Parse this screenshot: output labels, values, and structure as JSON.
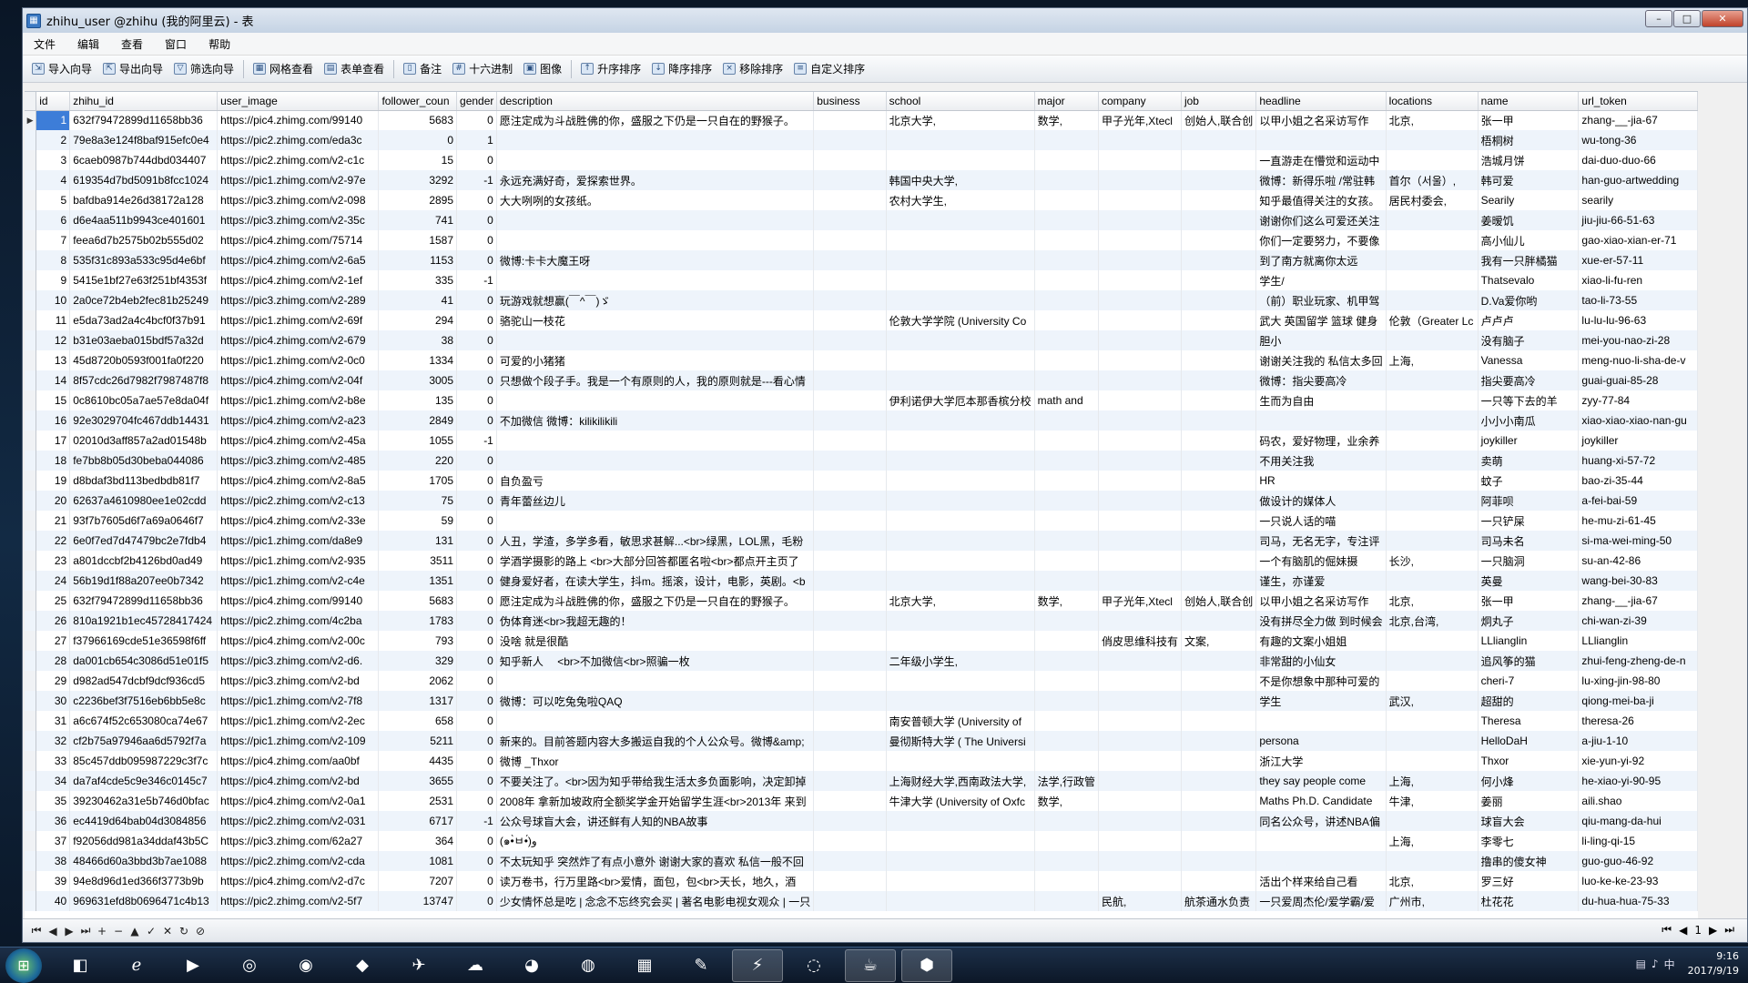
{
  "window": {
    "title": "zhihu_user @zhihu (我的阿里云) - 表"
  },
  "menu": [
    "文件",
    "编辑",
    "查看",
    "窗口",
    "帮助"
  ],
  "toolbar": {
    "import": "导入向导",
    "export": "导出向导",
    "filter": "筛选向导",
    "grid_view": "网格查看",
    "form_view": "表单查看",
    "memo": "备注",
    "hex": "十六进制",
    "image": "图像",
    "sort_asc": "升序排序",
    "sort_desc": "降序排序",
    "remove_sort": "移除排序",
    "custom_sort": "自定义排序"
  },
  "columns": [
    "id",
    "zhihu_id",
    "user_image",
    "follower_coun",
    "gender",
    "description",
    "business",
    "school",
    "major",
    "company",
    "job",
    "headline",
    "locations",
    "name",
    "url_token"
  ],
  "rows": [
    [
      "1",
      "632f79472899d11658bb36",
      "https://pic4.zhimg.com/99140",
      "5683",
      "0",
      "愿注定成为斗战胜佛的你，盛服之下仍是一只自在的野猴子。",
      "",
      "北京大学,",
      "数学,",
      "甲子光年,Xtecl",
      "创始人,联合创",
      "以甲小姐之名采访写作",
      "北京,",
      "张一甲",
      "zhang-__-jia-67"
    ],
    [
      "2",
      "79e8a3e124f8baf915efc0e4",
      "https://pic2.zhimg.com/eda3c",
      "0",
      "1",
      "",
      "",
      "",
      "",
      "",
      "",
      "",
      "",
      "梧桐树",
      "wu-tong-36"
    ],
    [
      "3",
      "6caeb0987b744dbd034407",
      "https://pic2.zhimg.com/v2-c1c",
      "15",
      "0",
      "",
      "",
      "",
      "",
      "",
      "",
      "一直游走在懵觉和运动中",
      "",
      "浩城月饼",
      "dai-duo-duo-66"
    ],
    [
      "4",
      "619354d7bd5091b8fcc1024",
      "https://pic1.zhimg.com/v2-97e",
      "3292",
      "-1",
      "永远充满好奇，爱探索世界。",
      "",
      "韩国中央大学,",
      "",
      "",
      "",
      "微博：新得乐啦 /常驻韩",
      "首尔（서울）,",
      "韩可爱",
      "han-guo-artwedding"
    ],
    [
      "5",
      "bafdba914e26d38172a128",
      "https://pic3.zhimg.com/v2-098",
      "2895",
      "0",
      "大大咧咧的女孩纸。",
      "",
      "农村大学生,",
      "",
      "",
      "",
      "知乎最值得关注的女孩。",
      "居民村委会,",
      "Searily",
      "searily"
    ],
    [
      "6",
      "d6e4aa511b9943ce401601",
      "https://pic3.zhimg.com/v2-35c",
      "741",
      "0",
      "",
      "",
      "",
      "",
      "",
      "",
      "谢谢你们这么可爱还关注",
      "",
      "姜暧饥",
      "jiu-jiu-66-51-63"
    ],
    [
      "7",
      "feea6d7b2575b02b555d02",
      "https://pic4.zhimg.com/75714",
      "1587",
      "0",
      "",
      "",
      "",
      "",
      "",
      "",
      "你们一定要努力，不要像",
      "",
      "高小仙儿",
      "gao-xiao-xian-er-71"
    ],
    [
      "8",
      "535f31c893a533c95d4e6bf",
      "https://pic4.zhimg.com/v2-6a5",
      "1153",
      "0",
      "微博:卡卡大魔王呀",
      "",
      "",
      "",
      "",
      "",
      "到了南方就离你太远",
      "",
      "我有一只胖橘猫",
      "xue-er-57-11"
    ],
    [
      "9",
      "5415e1bf27e63f251bf4353f",
      "https://pic4.zhimg.com/v2-1ef",
      "335",
      "-1",
      "",
      "",
      "",
      "",
      "",
      "",
      "学生/",
      "",
      "Thatsevalo",
      "xiao-li-fu-ren"
    ],
    [
      "10",
      "2a0ce72b4eb2fec81b25249",
      "https://pic3.zhimg.com/v2-289",
      "41",
      "0",
      "玩游戏就想赢(￣^￣)ゞ",
      "",
      "",
      "",
      "",
      "",
      "（前）职业玩家、机甲驾",
      "",
      "D.Va爱你哟",
      "tao-li-73-55"
    ],
    [
      "11",
      "e5da73ad2a4c4bcf0f37b91",
      "https://pic1.zhimg.com/v2-69f",
      "294",
      "0",
      "骆驼山一枝花",
      "",
      "伦敦大学学院 (University Co",
      "",
      "",
      "",
      "武大 英国留学 篮球 健身",
      "伦敦（Greater Lc",
      "卢卢卢",
      "lu-lu-lu-96-63"
    ],
    [
      "12",
      "b31e03aeba015bdf57a32d",
      "https://pic4.zhimg.com/v2-679",
      "38",
      "0",
      "",
      "",
      "",
      "",
      "",
      "",
      "胆小",
      "",
      "没有脑子",
      "mei-you-nao-zi-28"
    ],
    [
      "13",
      "45d8720b0593f001fa0f220",
      "https://pic1.zhimg.com/v2-0c0",
      "1334",
      "0",
      "可爱的小猪猪",
      "",
      "",
      "",
      "",
      "",
      "谢谢关注我的 私信太多回",
      "上海,",
      "Vanessa",
      "meng-nuo-li-sha-de-v"
    ],
    [
      "14",
      "8f57cdc26d7982f7987487f8",
      "https://pic4.zhimg.com/v2-04f",
      "3005",
      "0",
      "只想做个段子手。我是一个有原则的人，我的原则就是---看心情",
      "",
      "",
      "",
      "",
      "",
      "微博：指尖要高冷",
      "",
      "指尖要高冷",
      "guai-guai-85-28"
    ],
    [
      "15",
      "0c8610bc05a7ae57e8da04f",
      "https://pic1.zhimg.com/v2-b8e",
      "135",
      "0",
      "",
      "",
      "伊利诺伊大学厄本那香槟分校",
      "math and",
      "",
      "",
      "生而为自由",
      "",
      "一只等下去的羊",
      "zyy-77-84"
    ],
    [
      "16",
      "92e3029704fc467ddb14431",
      "https://pic4.zhimg.com/v2-a23",
      "2849",
      "0",
      "不加微信 微博：kilikilikili",
      "",
      "",
      "",
      "",
      "",
      "",
      "",
      "小小小南瓜",
      "xiao-xiao-xiao-nan-gu"
    ],
    [
      "17",
      "02010d3aff857a2ad01548b",
      "https://pic4.zhimg.com/v2-45a",
      "1055",
      "-1",
      "",
      "",
      "",
      "",
      "",
      "",
      "码农，爱好物理，业余养",
      "",
      "joykiller",
      "joykiller"
    ],
    [
      "18",
      "fe7bb8b05d30beba044086",
      "https://pic3.zhimg.com/v2-485",
      "220",
      "0",
      "",
      "",
      "",
      "",
      "",
      "",
      "不用关注我",
      "",
      "卖萌",
      "huang-xi-57-72"
    ],
    [
      "19",
      "d8bdaf3bd113bedbdb81f7",
      "https://pic4.zhimg.com/v2-8a5",
      "1705",
      "0",
      "自负盈亏",
      "",
      "",
      "",
      "",
      "",
      "HR",
      "",
      "蚊子",
      "bao-zi-35-44"
    ],
    [
      "20",
      "62637a4610980ee1e02cdd",
      "https://pic2.zhimg.com/v2-c13",
      "75",
      "0",
      "青年蕾丝边儿",
      "",
      "",
      "",
      "",
      "",
      "做设计的媒体人",
      "",
      "阿菲呗",
      "a-fei-bai-59"
    ],
    [
      "21",
      "93f7b7605d6f7a69a0646f7",
      "https://pic4.zhimg.com/v2-33e",
      "59",
      "0",
      "",
      "",
      "",
      "",
      "",
      "",
      "一只说人话的喵",
      "",
      "一只铲屎",
      "he-mu-zi-61-45"
    ],
    [
      "22",
      "6e0f7ed7d47479bc2e7fdb4",
      "https://pic1.zhimg.com/da8e9",
      "131",
      "0",
      "人丑，学渣，多学多看，敏思求甚解...<br>绿黑，LOL黑，毛粉",
      "",
      "",
      "",
      "",
      "",
      "司马，无名无字，专注评",
      "",
      "司马未名",
      "si-ma-wei-ming-50"
    ],
    [
      "23",
      "a801dccbf2b4126bd0ad49",
      "https://pic1.zhimg.com/v2-935",
      "3511",
      "0",
      "学酒学摄影的路上 <br>大部分回答都匿名啦<br>都点开主页了",
      "",
      "",
      "",
      "",
      "",
      "一个有脑肌的倔妹摄",
      "长沙,",
      "一只脑洞",
      "su-an-42-86"
    ],
    [
      "24",
      "56b19d1f88a207ee0b7342",
      "https://pic1.zhimg.com/v2-c4e",
      "1351",
      "0",
      "健身爱好者，在读大学生，抖m。摇滚，设计，电影，英剧。<b",
      "",
      "",
      "",
      "",
      "",
      "谨生，亦谨爱",
      "",
      "英曼",
      "wang-bei-30-83"
    ],
    [
      "25",
      "632f79472899d11658bb36",
      "https://pic4.zhimg.com/99140",
      "5683",
      "0",
      "愿注定成为斗战胜佛的你，盛服之下仍是一只自在的野猴子。",
      "",
      "北京大学,",
      "数学,",
      "甲子光年,Xtecl",
      "创始人,联合创",
      "以甲小姐之名采访写作",
      "北京,",
      "张一甲",
      "zhang-__-jia-67"
    ],
    [
      "26",
      "810a1921b1ec45728417424",
      "https://pic2.zhimg.com/4c2ba",
      "1783",
      "0",
      "伪体育迷<br>我超无趣的！",
      "",
      "",
      "",
      "",
      "",
      "没有拼尽全力做 到时候会",
      "北京,台湾,",
      "炯丸子",
      "chi-wan-zi-39"
    ],
    [
      "27",
      "f37966169cde51e36598f6ff",
      "https://pic4.zhimg.com/v2-00c",
      "793",
      "0",
      "没啥 就是很酷",
      "",
      "",
      "",
      "俏皮思维科技有",
      "文案,",
      "有趣的文案小姐姐",
      "",
      "LLlianglin",
      "LLlianglin"
    ],
    [
      "28",
      "da001cb654c3086d51e01f5",
      "https://pic3.zhimg.com/v2-d6.",
      "329",
      "0",
      "知乎新人 　<br>不加微信<br>照骗一枚",
      "",
      "二年级小学生,",
      "",
      "",
      "",
      "非常甜的小仙女",
      "",
      "追风筝的猫",
      "zhui-feng-zheng-de-n"
    ],
    [
      "29",
      "d982ad547dcbf9dcf936cd5",
      "https://pic3.zhimg.com/v2-bd",
      "2062",
      "0",
      "",
      "",
      "",
      "",
      "",
      "",
      "不是你想象中那种可爱的",
      "",
      "cheri-7",
      "lu-xing-jin-98-80"
    ],
    [
      "30",
      "c2236bef3f7516eb6bb5e8c",
      "https://pic1.zhimg.com/v2-7f8",
      "1317",
      "0",
      "微博：可以吃兔兔啦QAQ",
      "",
      "",
      "",
      "",
      "",
      "学生",
      "武汉,",
      "超甜的",
      "qiong-mei-ba-ji"
    ],
    [
      "31",
      "a6c674f52c653080ca74e67",
      "https://pic1.zhimg.com/v2-2ec",
      "658",
      "0",
      "",
      "",
      "南安普顿大学 (University of",
      "",
      "",
      "",
      "",
      "",
      "Theresa",
      "theresa-26"
    ],
    [
      "32",
      "cf2b75a97946aa6d5792f7a",
      "https://pic1.zhimg.com/v2-109",
      "5211",
      "0",
      "新来的。目前答题内容大多搬运自我的个人公众号。微博&amp;",
      "",
      "曼彻斯特大学 ( The Universi",
      "",
      "",
      "",
      "persona",
      "",
      "HelloDaH",
      "a-jiu-1-10"
    ],
    [
      "33",
      "85c457ddb095987229c3f7c",
      "https://pic4.zhimg.com/aa0bf",
      "4435",
      "0",
      "微博 _Thxor",
      "",
      "",
      "",
      "",
      "",
      "浙江大学",
      "",
      "Thxor",
      "xie-yun-yi-92"
    ],
    [
      "34",
      "da7af4cde5c9e346c0145c7",
      "https://pic4.zhimg.com/v2-bd",
      "3655",
      "0",
      "不要关注了。<br>因为知乎带给我生活太多负面影响，决定卸掉",
      "",
      "上海财经大学,西南政法大学,",
      "法学,行政管",
      "",
      "",
      "they say people come",
      "上海,",
      "何小烽",
      "he-xiao-yi-90-95"
    ],
    [
      "35",
      "39230462a31e5b746d0bfac",
      "https://pic4.zhimg.com/v2-0a1",
      "2531",
      "0",
      "2008年 拿新加坡政府全额奖学金开始留学生涯<br>2013年 来到",
      "",
      "牛津大学 (University of Oxfc",
      "数学,",
      "",
      "",
      "Maths Ph.D. Candidate",
      "牛津,",
      "姜丽",
      "aili.shao"
    ],
    [
      "36",
      "ec4419d64bab04d3084856",
      "https://pic2.zhimg.com/v2-031",
      "6717",
      "-1",
      "公众号球盲大会，讲还鲜有人知的NBA故事",
      "",
      "",
      "",
      "",
      "",
      "同名公众号，讲述NBA偏",
      "",
      "球盲大会",
      "qiu-mang-da-hui"
    ],
    [
      "37",
      "f92056dd981a34ddaf43b5C",
      "https://pic3.zhimg.com/62a27",
      "364",
      "0",
      "(๑•̀ㅂ•́)و",
      "",
      "",
      "",
      "",
      "",
      "",
      "上海,",
      "李零七",
      "li-ling-qi-15"
    ],
    [
      "38",
      "48466d60a3bbd3b7ae1088",
      "https://pic2.zhimg.com/v2-cda",
      "1081",
      "0",
      "不太玩知乎 突然炸了有点小意外 谢谢大家的喜欢 私信一般不回",
      "",
      "",
      "",
      "",
      "",
      "",
      "",
      "撸串的傻女神",
      "guo-guo-46-92"
    ],
    [
      "39",
      "94e8d96d1ed366f3773b9b",
      "https://pic4.zhimg.com/v2-d7c",
      "7207",
      "0",
      "读万卷书，行万里路<br>爱情，面包，包<br>天长，地久，酒",
      "",
      "",
      "",
      "",
      "",
      "活出个样来给自己看",
      "北京,",
      "罗三好",
      "luo-ke-ke-23-93"
    ],
    [
      "40",
      "969631efd8b0696471c4b13",
      "https://pic2.zhimg.com/v2-5f7",
      "13747",
      "0",
      "少女情怀总是吃 | 念念不忘终究会买 | 著名电影电视女观众 | 一只",
      "",
      "",
      "",
      "民航,",
      "航茶通水负责",
      "一只爱周杰伦/爱学霸/爱",
      "广州市,",
      "杜花花",
      "du-hua-hua-75-33"
    ]
  ],
  "navbar": {
    "buttons": [
      "⏮",
      "◀",
      "▶",
      "⏭",
      "+",
      "−",
      "▲",
      "✓",
      "✕",
      "↻",
      "⊘"
    ],
    "page": "1"
  },
  "taskbar": {
    "apps": [
      "start",
      "explorer-icon",
      "ie-icon",
      "media-icon",
      "360-icon",
      "chrome-icon",
      "qq-icon",
      "feiq-icon",
      "baidu-icon",
      "penguin-icon",
      "firefox-icon",
      "office-icon",
      "note-icon",
      "thunder-icon",
      "wechat-icon",
      "java-icon",
      "navicat-icon"
    ],
    "time": "9:16",
    "date": "2017/9/19"
  },
  "colors": {
    "selected": "#3d7dd8",
    "alt_row": "#eef4fb"
  }
}
